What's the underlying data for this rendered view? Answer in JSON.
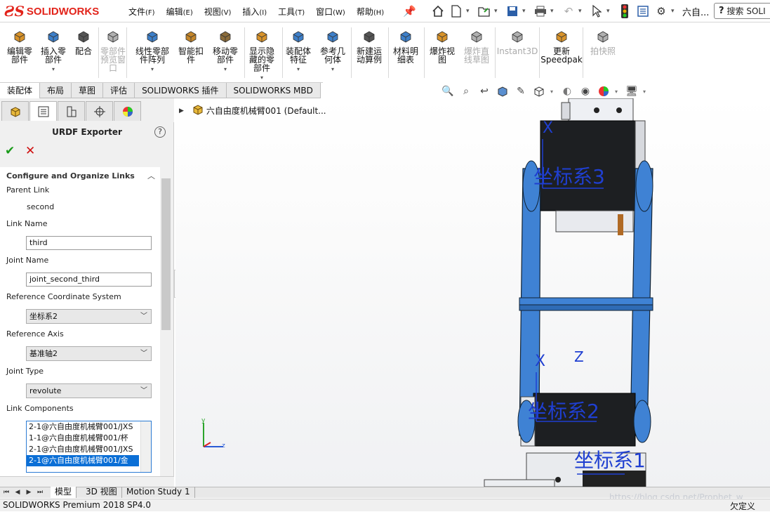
{
  "app": {
    "logo_ds": "ƧS",
    "logo_text": "SOLIDWORKS",
    "document_title": "六自...",
    "search_placeholder": "搜索 SOLI"
  },
  "menu": [
    {
      "label": "文件",
      "acc": "(F)"
    },
    {
      "label": "编辑",
      "acc": "(E)"
    },
    {
      "label": "视图",
      "acc": "(V)"
    },
    {
      "label": "插入",
      "acc": "(I)"
    },
    {
      "label": "工具",
      "acc": "(T)"
    },
    {
      "label": "窗口",
      "acc": "(W)"
    },
    {
      "label": "帮助",
      "acc": "(H)"
    }
  ],
  "ribbon": [
    {
      "l1": "编辑零",
      "l2": "部件",
      "l3": "",
      "icon": "edit-component-icon",
      "color": "#d8932a"
    },
    {
      "l1": "插入零",
      "l2": "部件",
      "l3": "",
      "icon": "insert-component-icon",
      "color": "#3d7fc9"
    },
    {
      "l1": "配合",
      "l2": "",
      "l3": "",
      "icon": "mate-icon",
      "color": "#555"
    },
    {
      "l1": "零部件",
      "l2": "预览窗",
      "l3": "口",
      "icon": "preview-window-icon",
      "color": "#b0b0b0"
    },
    {
      "l1": "线性零部",
      "l2": "件阵列",
      "l3": "",
      "icon": "linear-pattern-icon",
      "color": "#3d7fc9"
    },
    {
      "l1": "智能扣",
      "l2": "件",
      "l3": "",
      "icon": "smart-fasteners-icon",
      "color": "#c4862a"
    },
    {
      "l1": "移动零",
      "l2": "部件",
      "l3": "",
      "icon": "move-component-icon",
      "color": "#8a6b3a"
    },
    {
      "l1": "显示隐",
      "l2": "藏的零",
      "l3": "部件",
      "icon": "show-hidden-icon",
      "color": "#d8932a"
    },
    {
      "l1": "装配体",
      "l2": "特征",
      "l3": "",
      "icon": "assembly-features-icon",
      "color": "#3d7fc9"
    },
    {
      "l1": "参考几",
      "l2": "何体",
      "l3": "",
      "icon": "reference-geometry-icon",
      "color": "#3d7fc9"
    },
    {
      "l1": "新建运",
      "l2": "动算例",
      "l3": "",
      "icon": "new-motion-study-icon",
      "color": "#555"
    },
    {
      "l1": "材料明",
      "l2": "细表",
      "l3": "",
      "icon": "bill-of-materials-icon",
      "color": "#3d7fc9"
    },
    {
      "l1": "爆炸视",
      "l2": "图",
      "l3": "",
      "icon": "exploded-view-icon",
      "color": "#d8932a"
    },
    {
      "l1": "爆炸直",
      "l2": "线草图",
      "l3": "",
      "icon": "explode-line-sketch-icon",
      "color": "#b0b0b0"
    },
    {
      "l1": "Instant3D",
      "l2": "",
      "l3": "",
      "icon": "instant3d-icon",
      "color": "#b0b0b0"
    },
    {
      "l1": "更新",
      "l2": "Speedpak",
      "l3": "",
      "icon": "speedpak-icon",
      "color": "#d8932a"
    },
    {
      "l1": "拍快照",
      "l2": "",
      "l3": "",
      "icon": "snapshot-icon",
      "color": "#b0b0b0"
    }
  ],
  "command_tabs": [
    "装配体",
    "布局",
    "草图",
    "评估",
    "SOLIDWORKS 插件",
    "SOLIDWORKS MBD"
  ],
  "property_manager": {
    "title": "URDF Exporter",
    "help": "?",
    "ok": "✔",
    "cancel": "✕",
    "group_title": "Configure and Organize Links",
    "parent_link_label": "Parent Link",
    "parent_link_value": "second",
    "link_name_label": "Link Name",
    "link_name_value": "third",
    "joint_name_label": "Joint Name",
    "joint_name_value": "joint_second_third",
    "ref_cs_label": "Reference Coordinate System",
    "ref_cs_value": "坐标系2",
    "ref_axis_label": "Reference Axis",
    "ref_axis_value": "基准轴2",
    "joint_type_label": "Joint Type",
    "joint_type_value": "revolute",
    "link_components_label": "Link Components",
    "link_components": [
      "2-1@六自由度机械臂001/JXS",
      "1-1@六自由度机械臂001/杯",
      "2-1@六自由度机械臂001/JXS",
      "2-1@六自由度机械臂001/金"
    ],
    "selected_index": 3
  },
  "tree": {
    "root": "六自由度机械臂001  (Default..."
  },
  "viewport": {
    "cs3_label": "坐标系3",
    "cs2_label": "坐标系2",
    "cs1_label": "坐标系1",
    "axis_x": "X",
    "axis_z": "Z",
    "triad_y": "y",
    "triad_z": "z"
  },
  "bottom_tabs": [
    "模型",
    "3D 视图",
    "Motion Study 1"
  ],
  "status": {
    "left": "SOLIDWORKS Premium 2018 SP4.0",
    "right": "欠定义",
    "watermark": "https://blog.csdn.net/Prophet_w"
  },
  "colors": {
    "brand_red": "#e2231a",
    "ok_green": "#1a9b1a",
    "cancel_red": "#d01010",
    "selection_blue": "#0b6fd6",
    "arm_blue": "#3f82d4",
    "coord_blue": "#1f3fd1"
  }
}
